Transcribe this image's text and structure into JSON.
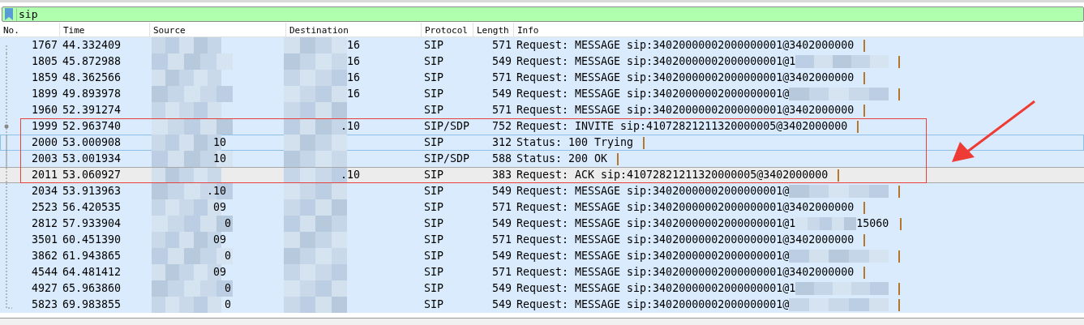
{
  "filter": {
    "value": "sip"
  },
  "columns": [
    "No.",
    "Time",
    "Source",
    "Destination",
    "Protocol",
    "Length",
    "Info"
  ],
  "rows": [
    {
      "no": "1767",
      "time": "44.332409",
      "source": "",
      "destination": "16",
      "protocol": "SIP",
      "length": "571",
      "info": "Request: MESSAGE sip:34020000002000000001@3402000000",
      "info_redacted": false,
      "kind": "first",
      "selected": false,
      "focused": false,
      "highlighted": false
    },
    {
      "no": "1805",
      "time": "45.872988",
      "source": "",
      "destination": "16",
      "protocol": "SIP",
      "length": "549",
      "info": "Request: MESSAGE sip:34020000002000000001@1",
      "info_redacted": true,
      "kind": "dashed",
      "selected": false,
      "focused": false,
      "highlighted": false
    },
    {
      "no": "1859",
      "time": "48.362566",
      "source": "",
      "destination": "16",
      "protocol": "SIP",
      "length": "571",
      "info": "Request: MESSAGE sip:34020000002000000001@3402000000",
      "info_redacted": false,
      "kind": "dashed",
      "selected": false,
      "focused": false,
      "highlighted": false
    },
    {
      "no": "1899",
      "time": "49.893978",
      "source": "",
      "destination": "16",
      "protocol": "SIP",
      "length": "549",
      "info": "Request: MESSAGE sip:34020000002000000001@",
      "info_redacted": true,
      "kind": "dashed",
      "selected": false,
      "focused": false,
      "highlighted": false
    },
    {
      "no": "1960",
      "time": "52.391274",
      "source": "",
      "destination": "",
      "protocol": "SIP",
      "length": "571",
      "info": "Request: MESSAGE sip:34020000002000000001@3402000000",
      "info_redacted": false,
      "kind": "dashed",
      "selected": false,
      "focused": false,
      "highlighted": false
    },
    {
      "no": "1999",
      "time": "52.963740",
      "source": "",
      "destination": ".10",
      "protocol": "SIP/SDP",
      "length": "752",
      "info": "Request: INVITE sip:41072821211320000005@3402000000",
      "info_redacted": false,
      "kind": "dot",
      "selected": false,
      "focused": false,
      "highlighted": true
    },
    {
      "no": "2000",
      "time": "53.000908",
      "source": "10",
      "destination": "",
      "protocol": "SIP",
      "length": "312",
      "info": "Status: 100 Trying",
      "info_redacted": false,
      "kind": "solid",
      "selected": false,
      "focused": true,
      "highlighted": true
    },
    {
      "no": "2003",
      "time": "53.001934",
      "source": "10",
      "destination": "",
      "protocol": "SIP/SDP",
      "length": "588",
      "info": "Status: 200 OK",
      "info_redacted": false,
      "kind": "solid",
      "selected": false,
      "focused": false,
      "highlighted": true
    },
    {
      "no": "2011",
      "time": "53.060927",
      "source": "",
      "destination": ".10",
      "protocol": "SIP",
      "length": "383",
      "info": "Request: ACK sip:41072821211320000005@3402000000",
      "info_redacted": false,
      "kind": "dashed",
      "selected": true,
      "focused": false,
      "highlighted": true
    },
    {
      "no": "2034",
      "time": "53.913963",
      "source": ".10",
      "destination": "",
      "protocol": "SIP",
      "length": "549",
      "info": "Request: MESSAGE sip:34020000002000000001@",
      "info_redacted": true,
      "kind": "dashed",
      "selected": false,
      "focused": false,
      "highlighted": false
    },
    {
      "no": "2523",
      "time": "56.420535",
      "source": "09",
      "destination": "",
      "protocol": "SIP",
      "length": "571",
      "info": "Request: MESSAGE sip:34020000002000000001@3402000000",
      "info_redacted": false,
      "kind": "dashed",
      "selected": false,
      "focused": false,
      "highlighted": false
    },
    {
      "no": "2812",
      "time": "57.933904",
      "source": "0",
      "destination": "",
      "protocol": "SIP",
      "length": "549",
      "info": "Request: MESSAGE sip:34020000002000000001@1",
      "info_redacted": true,
      "info_tail": "15060",
      "kind": "dashed",
      "selected": false,
      "focused": false,
      "highlighted": false
    },
    {
      "no": "3501",
      "time": "60.451390",
      "source": "09",
      "destination": "",
      "protocol": "SIP",
      "length": "571",
      "info": "Request: MESSAGE sip:34020000002000000001@3402000000",
      "info_redacted": false,
      "kind": "dashed",
      "selected": false,
      "focused": false,
      "highlighted": false
    },
    {
      "no": "3862",
      "time": "61.943865",
      "source": "0",
      "destination": "",
      "protocol": "SIP",
      "length": "549",
      "info": "Request: MESSAGE sip:34020000002000000001@",
      "info_redacted": true,
      "kind": "dashed",
      "selected": false,
      "focused": false,
      "highlighted": false
    },
    {
      "no": "4544",
      "time": "64.481412",
      "source": "09",
      "destination": "",
      "protocol": "SIP",
      "length": "571",
      "info": "Request: MESSAGE sip:34020000002000000001@3402000000",
      "info_redacted": false,
      "kind": "dashed",
      "selected": false,
      "focused": false,
      "highlighted": false
    },
    {
      "no": "4927",
      "time": "65.963860",
      "source": "0",
      "destination": "",
      "protocol": "SIP",
      "length": "549",
      "info": "Request: MESSAGE sip:34020000002000000001@1",
      "info_redacted": true,
      "kind": "dashed",
      "selected": false,
      "focused": false,
      "highlighted": false
    },
    {
      "no": "5823",
      "time": "69.983855",
      "source": "0",
      "destination": "",
      "protocol": "SIP",
      "length": "549",
      "info": "Request: MESSAGE sip:34020000002000000001@",
      "info_redacted": true,
      "kind": "last",
      "selected": false,
      "focused": false,
      "highlighted": false
    }
  ]
}
